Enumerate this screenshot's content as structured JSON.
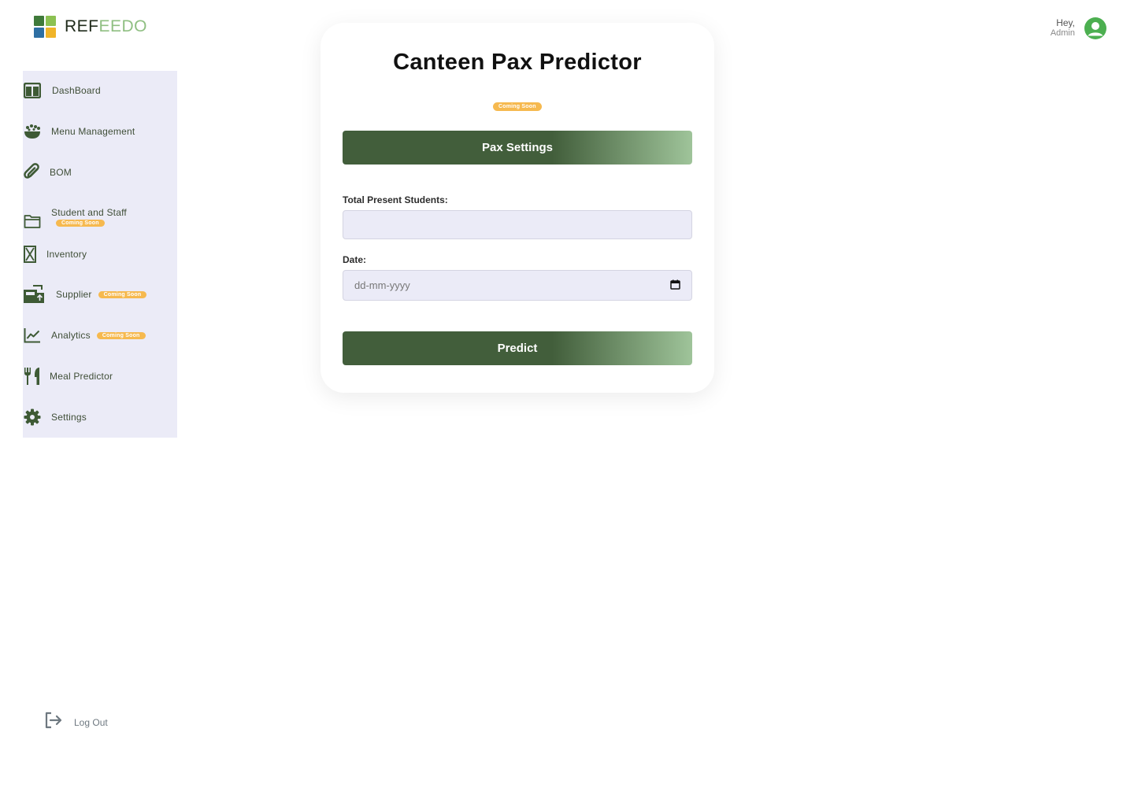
{
  "brand": {
    "name_part1": "REF",
    "name_part2": "EEDO"
  },
  "user": {
    "greeting": "Hey,",
    "role": "Admin"
  },
  "sidebar": {
    "items": [
      {
        "label": "DashBoard",
        "icon": "dashboard-icon"
      },
      {
        "label": "Menu Management",
        "icon": "menu-bowl-icon"
      },
      {
        "label": "BOM",
        "icon": "paperclip-icon"
      },
      {
        "label": "Student and Staff",
        "icon": "folder-icon",
        "badge": "Coming Soon"
      },
      {
        "label": "Inventory",
        "icon": "inventory-icon"
      },
      {
        "label": "Supplier",
        "icon": "supplier-icon",
        "badge": "Coming Soon"
      },
      {
        "label": "Analytics",
        "icon": "chart-line-icon",
        "badge": "Coming Soon"
      },
      {
        "label": "Meal Predictor",
        "icon": "utensils-icon"
      },
      {
        "label": "Settings",
        "icon": "gear-icon"
      }
    ]
  },
  "card": {
    "title": "Canteen Pax Predictor",
    "badge": "Coming Soon",
    "pax_settings_label": "Pax Settings",
    "students_label": "Total Present Students:",
    "students_value": "",
    "date_label": "Date:",
    "date_placeholder": "dd-mm-yyyy",
    "predict_label": "Predict"
  },
  "logout": {
    "label": "Log Out"
  },
  "colors": {
    "primary": "#425e3b",
    "accent_light": "#9fc49a",
    "badge": "#f6b94f",
    "sidebar_bg": "#ebebf7",
    "avatar": "#4caf50"
  }
}
